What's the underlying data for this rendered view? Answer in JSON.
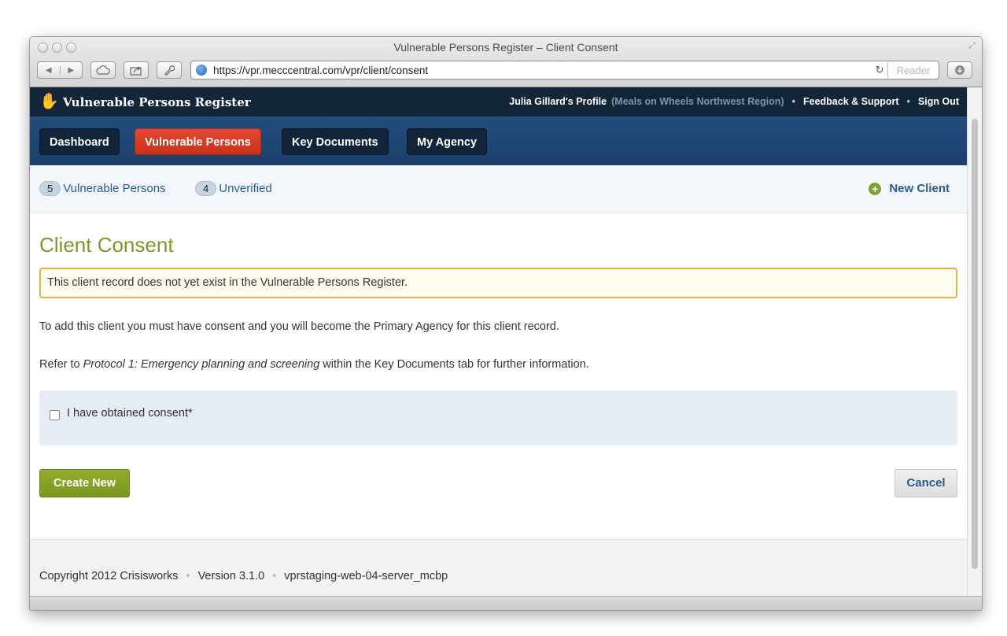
{
  "window": {
    "title": "Vulnerable Persons Register – Client Consent"
  },
  "toolbar": {
    "url": "https://vpr.mecccentral.com/vpr/client/consent",
    "reader_label": "Reader",
    "icons": [
      "back-icon",
      "forward-icon",
      "cloud-icon",
      "share-icon",
      "wrench-icon",
      "globe-icon",
      "reload-icon",
      "download-icon"
    ]
  },
  "header": {
    "site_name": "Vulnerable Persons Register",
    "profile": "Julia Gillard's Profile",
    "agency": "(Meals on Wheels Northwest Region)",
    "feedback": "Feedback & Support",
    "signout": "Sign Out",
    "separator": "•"
  },
  "nav": {
    "items": [
      {
        "label": "Dashboard",
        "active": false
      },
      {
        "label": "Vulnerable Persons",
        "active": true
      },
      {
        "label": "Key Documents",
        "active": false
      },
      {
        "label": "My Agency",
        "active": false
      }
    ]
  },
  "subbar": {
    "vulnerable_count": "5",
    "vulnerable_label": "Vulnerable Persons",
    "unverified_count": "4",
    "unverified_label": "Unverified",
    "new_client": "New Client"
  },
  "main": {
    "title": "Client Consent",
    "alert": "This client record does not yet exist in the Vulnerable Persons Register.",
    "para1": "To add this client you must have consent and you will become the Primary Agency for this client record.",
    "para2_prefix": "Refer to ",
    "para2_italic": "Protocol 1: Emergency planning and screening",
    "para2_suffix": " within the Key Documents tab for further information.",
    "consent_label": "I have obtained consent*",
    "consent_checked": false,
    "create_button": "Create New",
    "cancel_button": "Cancel"
  },
  "footer": {
    "copyright": "Copyright 2012 Crisisworks",
    "version": "Version 3.1.0",
    "server": "vprstaging-web-04-server_mcbp",
    "separator": "•"
  },
  "colors": {
    "header_bg": "#132538",
    "nav_bg": "#1f4572",
    "active_tab": "#d63d25",
    "title_green": "#7a9a2a",
    "create_green": "#86a228",
    "link_blue": "#2a5a95",
    "alert_border": "#e8b04a"
  }
}
